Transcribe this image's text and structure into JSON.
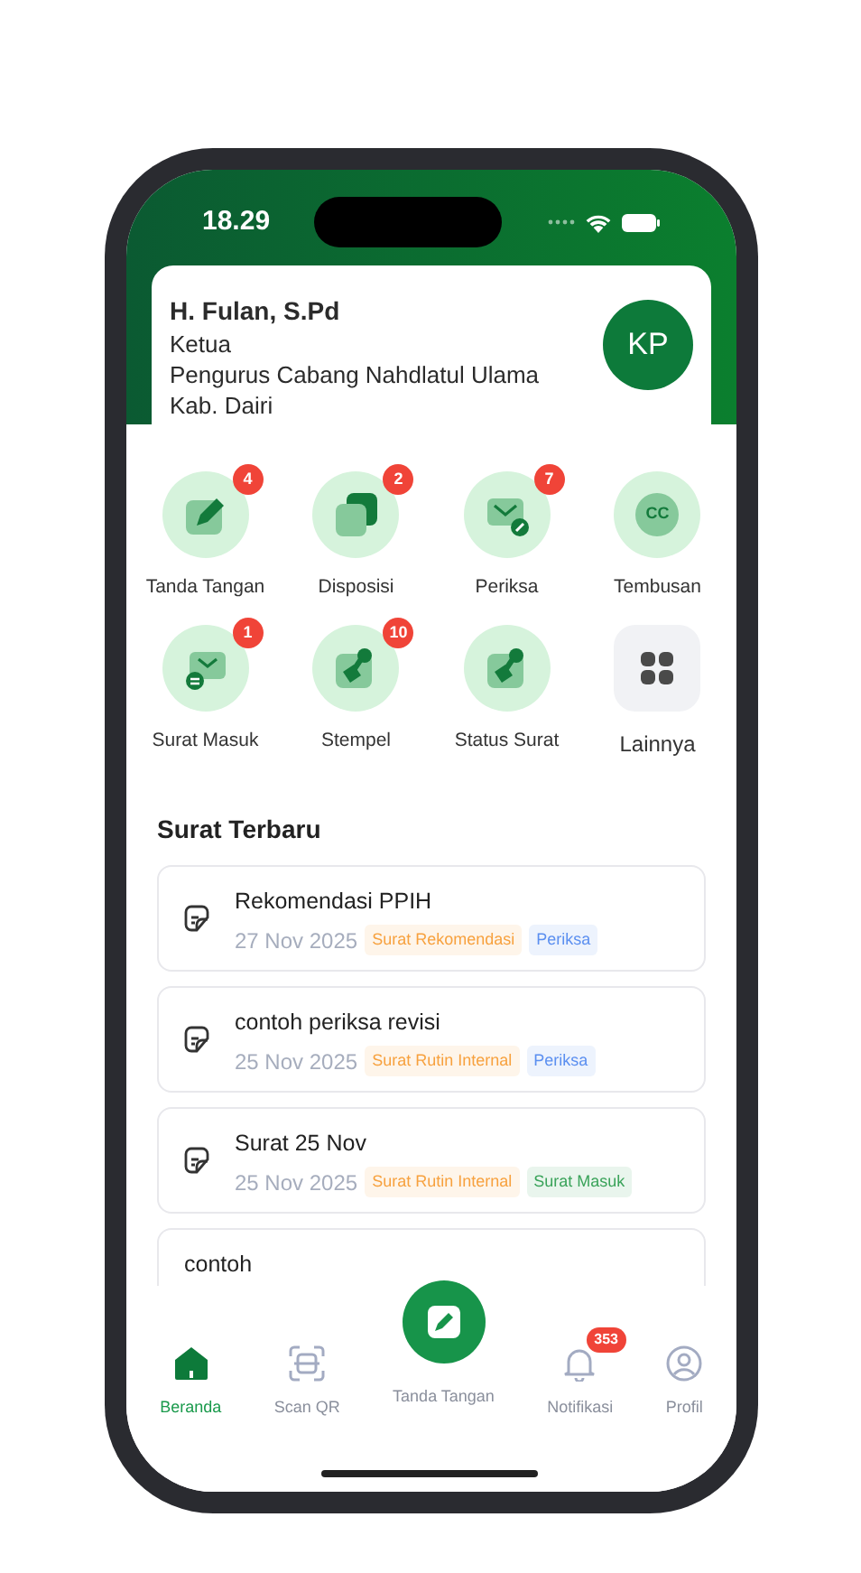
{
  "status_bar": {
    "time": "18.29"
  },
  "profile": {
    "name": "H. Fulan, S.Pd",
    "role": "Ketua",
    "organization": "Pengurus Cabang Nahdlatul Ulama",
    "region": "Kab. Dairi",
    "avatar_initials": "KP"
  },
  "menu": [
    {
      "kind": "sign",
      "label": "Tanda Tangan",
      "badge": "4"
    },
    {
      "kind": "disposition",
      "label": "Disposisi",
      "badge": "2"
    },
    {
      "kind": "review",
      "label": "Periksa",
      "badge": "7"
    },
    {
      "kind": "cc",
      "label": "Tembusan",
      "icon_text": "CC"
    },
    {
      "kind": "inbox",
      "label": "Surat Masuk",
      "badge": "1"
    },
    {
      "kind": "stamp",
      "label": "Stempel",
      "badge": "10"
    },
    {
      "kind": "status",
      "label": "Status Surat"
    },
    {
      "kind": "more",
      "label": "Lainnya"
    }
  ],
  "recent": {
    "title": "Surat Terbaru",
    "letters": [
      {
        "title": "Rekomendasi PPIH",
        "date": "27 Nov 2025",
        "tags": [
          {
            "label": "Surat Rekomendasi",
            "color": "#f7a13e"
          },
          {
            "label": "Periksa",
            "color": "#5b8ff0"
          }
        ]
      },
      {
        "title": "contoh periksa revisi",
        "date": "25 Nov 2025",
        "tags": [
          {
            "label": "Surat Rutin Internal",
            "color": "#f7a13e"
          },
          {
            "label": "Periksa",
            "color": "#5b8ff0"
          }
        ]
      },
      {
        "title": "Surat 25 Nov",
        "date": "25 Nov 2025",
        "tags": [
          {
            "label": "Surat Rutin Internal",
            "color": "#f7a13e"
          },
          {
            "label": "Surat Masuk",
            "color": "#3aa35a"
          }
        ]
      },
      {
        "title": "contoh"
      }
    ]
  },
  "bottom_nav": [
    {
      "kind": "home",
      "label": "Beranda",
      "selected": true
    },
    {
      "kind": "scan",
      "label": "Scan QR",
      "selected": false
    },
    {
      "kind": "fab",
      "label": "Tanda Tangan",
      "selected": false
    },
    {
      "kind": "bell",
      "label": "Notifikasi",
      "selected": false,
      "badge": "353"
    },
    {
      "kind": "profile",
      "label": "Profil",
      "selected": false
    }
  ]
}
